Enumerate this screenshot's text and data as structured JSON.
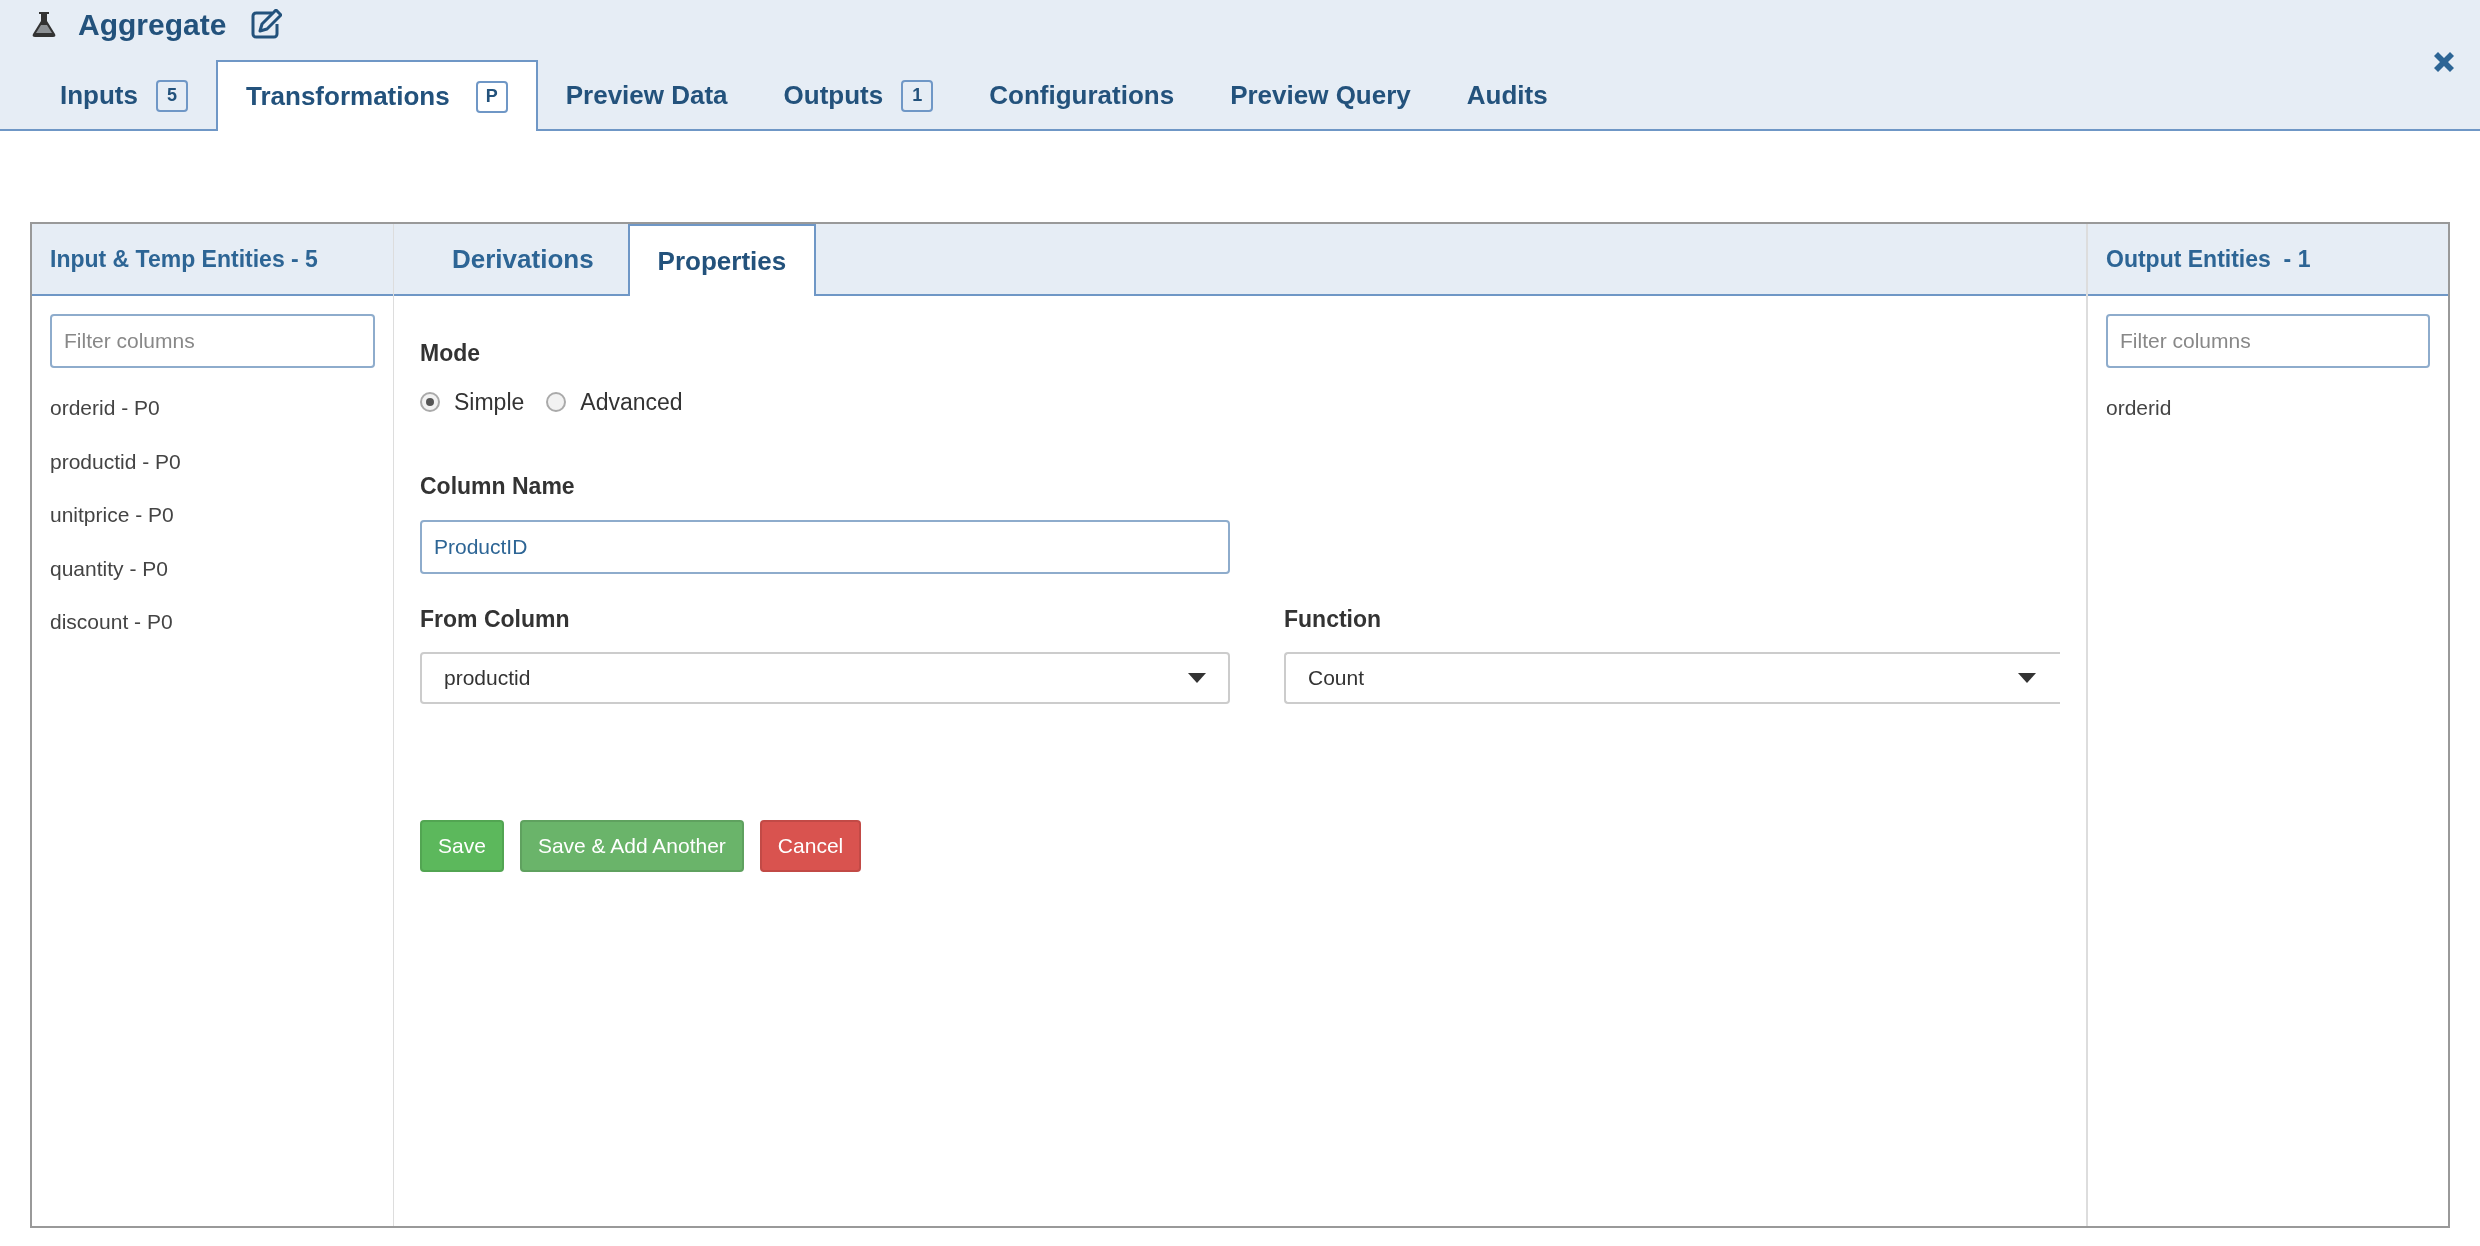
{
  "header": {
    "title": "Aggregate"
  },
  "tabs": [
    {
      "label": "Inputs",
      "badge": "5",
      "selected": false
    },
    {
      "label": "Transformations",
      "badge": "P",
      "selected": true
    },
    {
      "label": "Preview Data",
      "selected": false
    },
    {
      "label": "Outputs",
      "badge": "1",
      "selected": false
    },
    {
      "label": "Configurations",
      "selected": false
    },
    {
      "label": "Preview Query",
      "selected": false
    },
    {
      "label": "Audits",
      "selected": false
    }
  ],
  "left_panel": {
    "title": "Input & Temp Entities - 5",
    "filter": {
      "placeholder": "Filter columns"
    },
    "items": [
      "orderid - P0",
      "productid - P0",
      "unitprice - P0",
      "quantity - P0",
      "discount - P0"
    ]
  },
  "center": {
    "tabs": [
      {
        "label": "Derivations",
        "selected": false
      },
      {
        "label": "Properties",
        "selected": true
      }
    ],
    "mode": {
      "label": "Mode",
      "options": [
        {
          "label": "Simple",
          "selected": true
        },
        {
          "label": "Advanced",
          "selected": false
        }
      ]
    },
    "column_name": {
      "label": "Column Name",
      "value": "ProductID"
    },
    "from_column": {
      "label": "From Column",
      "value": "productid"
    },
    "function": {
      "label": "Function",
      "value": "Count"
    },
    "buttons": [
      {
        "label": "Save",
        "color": "#5cb85c"
      },
      {
        "label": "Save & Add Another",
        "color": "#6ab46a"
      },
      {
        "label": "Cancel",
        "color": "#d9534f"
      }
    ]
  },
  "right_panel": {
    "title": "Output Entities  - 1",
    "filter": {
      "placeholder": "Filter columns"
    },
    "items": [
      "orderid"
    ]
  }
}
